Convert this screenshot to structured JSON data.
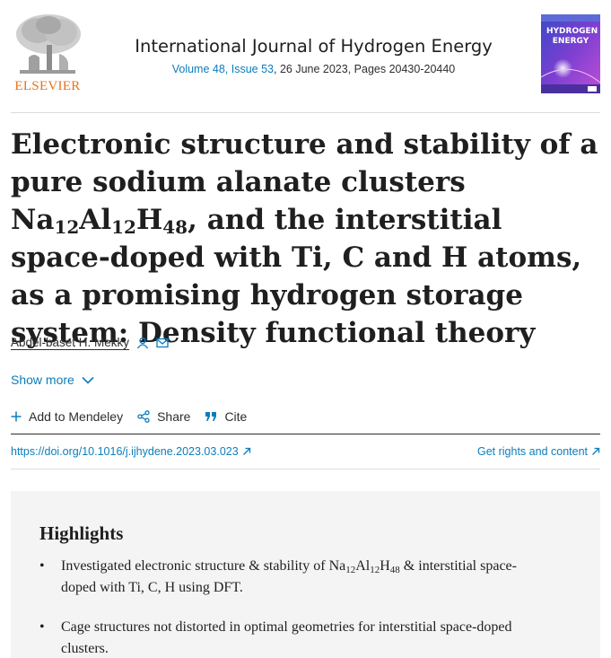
{
  "publisher": {
    "name": "ELSEVIER"
  },
  "journal": {
    "title": "International Journal of Hydrogen Energy",
    "volume_issue": "Volume 48, Issue 53",
    "date_pages": ", 26 June 2023, Pages 20430-20440",
    "cover_text": "HYDROGEN ENERGY"
  },
  "article": {
    "title_parts": {
      "a": "Electronic structure and stability of a pure sodium alanate clusters Na",
      "s1": "12",
      "b": "Al",
      "s2": "12",
      "c": "H",
      "s3": "48",
      "d": ", and the interstitial space-doped with Ti, C and H atoms, as a promising hydrogen storage system: Density functional theory"
    },
    "author": "Abdel-baset H. Mekky",
    "show_more": "Show more",
    "actions": {
      "mendeley": "Add to Mendeley",
      "share": "Share",
      "cite": "Cite"
    },
    "doi": "https://doi.org/10.1016/j.ijhydene.2023.03.023",
    "rights": "Get rights and content"
  },
  "highlights": {
    "title": "Highlights",
    "item1": {
      "a": "Investigated electronic structure & stability of Na",
      "s1": "12",
      "b": "Al",
      "s2": "12",
      "c": "H",
      "s3": "48",
      "d": " & interstitial space-doped with Ti, C, H using DFT."
    },
    "item2": "Cage structures not distorted in optimal geometries for interstitial space-doped clusters.",
    "bullet": "•"
  },
  "colors": {
    "link": "#0c7dbb",
    "elsevier_orange": "#e9711c",
    "panel": "#f4f4f4"
  },
  "icons": [
    "person-icon",
    "mail-icon",
    "chevron-down-icon",
    "plus-icon",
    "share-icon",
    "quote-icon",
    "external-link-icon"
  ]
}
